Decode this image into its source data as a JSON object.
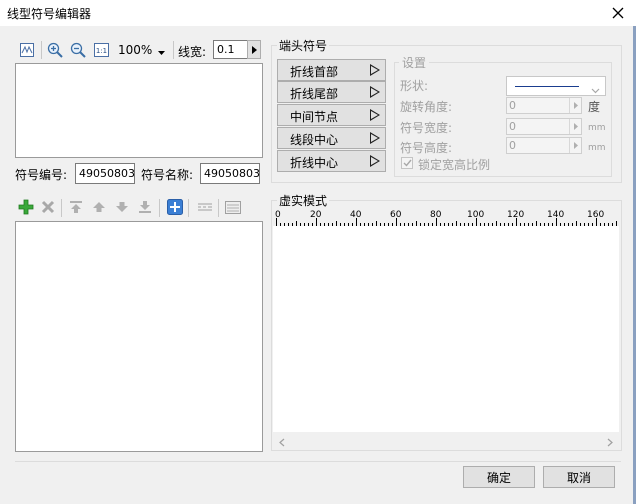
{
  "window": {
    "title": "线型符号编辑器"
  },
  "toolbar": {
    "zoom_value": "100%",
    "line_width_label": "线宽:",
    "line_width_value": "0.1"
  },
  "symbol": {
    "code_label": "符号编号:",
    "code_value": "49050803",
    "name_label": "符号名称:",
    "name_value": "49050803"
  },
  "end_symbol": {
    "group_label": "端头符号",
    "buttons": [
      "折线首部",
      "折线尾部",
      "中间节点",
      "线段中心",
      "折线中心"
    ]
  },
  "settings": {
    "group_label": "设置",
    "shape_label": "形状:",
    "rotation_label": "旋转角度:",
    "rotation_value": "0",
    "rotation_unit": "度",
    "width_label": "符号宽度:",
    "width_value": "0",
    "width_unit": "mm",
    "height_label": "符号高度:",
    "height_value": "0",
    "height_unit": "mm",
    "lock_label": "锁定宽高比例"
  },
  "dash_mode": {
    "group_label": "虚实模式",
    "ruler_labels": [
      "0",
      "20",
      "40",
      "60",
      "80",
      "100",
      "120",
      "140",
      "160"
    ]
  },
  "footer": {
    "ok_label": "确定",
    "cancel_label": "取消"
  }
}
